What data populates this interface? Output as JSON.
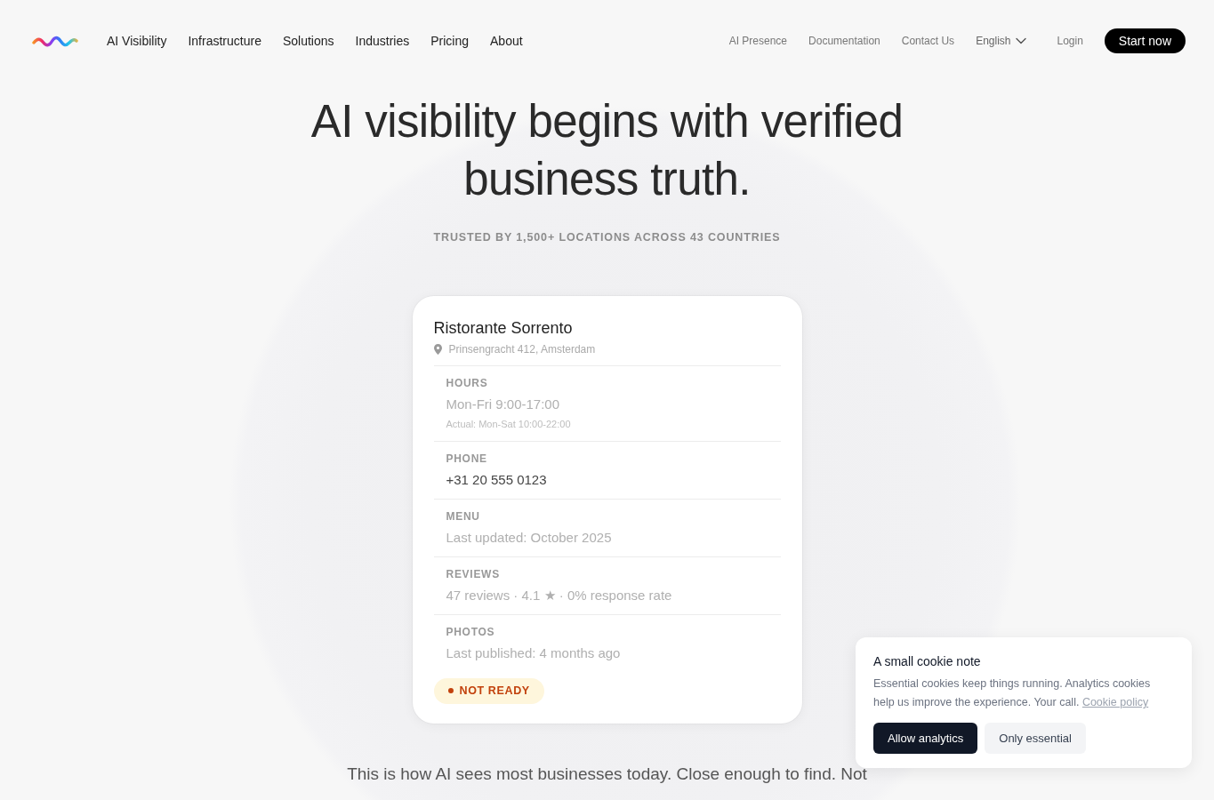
{
  "nav": {
    "links": [
      {
        "label": "AI Visibility"
      },
      {
        "label": "Infrastructure"
      },
      {
        "label": "Solutions"
      },
      {
        "label": "Industries"
      },
      {
        "label": "Pricing"
      },
      {
        "label": "About"
      }
    ],
    "secondary_links": [
      {
        "label": "AI Presence"
      },
      {
        "label": "Documentation"
      },
      {
        "label": "Contact Us"
      }
    ],
    "language": "English",
    "login": "Login",
    "cta": "Start now"
  },
  "hero": {
    "title": "AI visibility begins with verified business truth.",
    "subtitle": "TRUSTED BY 1,500+ LOCATIONS ACROSS 43 COUNTRIES"
  },
  "card": {
    "name": "Ristorante Sorrento",
    "address": "Prinsengracht 412, Amsterdam",
    "fields": [
      {
        "label": "HOURS",
        "value": "Mon-Fri 9:00-17:00",
        "note": "Actual: Mon-Sat 10:00-22:00",
        "muted": true
      },
      {
        "label": "PHONE",
        "value": "+31 20 555 0123",
        "muted": false
      },
      {
        "label": "MENU",
        "value": "Last updated: October 2025",
        "muted": true
      },
      {
        "label": "REVIEWS",
        "value": "47 reviews · 4.1 ★ · 0% response rate",
        "muted": true
      },
      {
        "label": "PHOTOS",
        "value": "Last published: 4 months ago",
        "muted": true
      }
    ],
    "status": "NOT READY"
  },
  "tagline": "This is how AI sees most businesses today. Close enough to find. Not",
  "cookie_notice": {
    "title": "A small cookie note",
    "text": "Essential cookies keep things running. Analytics cookies help us improve the experience. Your call.",
    "link": "Cookie policy",
    "buttons": [
      {
        "label": "Allow analytics",
        "kind": "primary"
      },
      {
        "label": "Only essential",
        "kind": "secondary"
      }
    ]
  }
}
